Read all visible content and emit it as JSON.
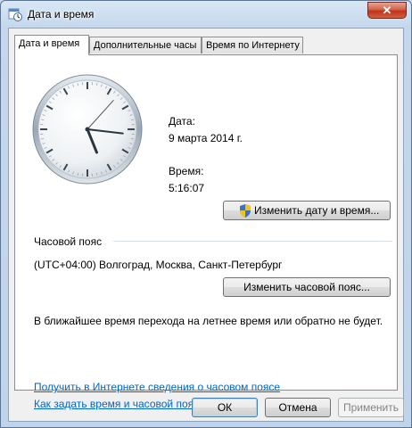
{
  "window": {
    "title": "Дата и время",
    "close_symbol": "✕"
  },
  "tabs": [
    {
      "label": "Дата и время",
      "active": true
    },
    {
      "label": "Дополнительные часы",
      "active": false
    },
    {
      "label": "Время по Интернету",
      "active": false
    }
  ],
  "datetime": {
    "date_label": "Дата:",
    "date_value": "9 марта 2014 г.",
    "time_label": "Время:",
    "time_value": "5:16:07",
    "change_button": "Изменить дату и время..."
  },
  "timezone": {
    "section_label": "Часовой пояс",
    "value": "(UTC+04:00) Волгоград, Москва, Санкт-Петербург",
    "change_button": "Изменить часовой пояс...",
    "dst_note": "В ближайшее время перехода на летнее время или обратно не будет."
  },
  "links": {
    "online_info": "Получить в Интернете сведения о часовом поясе",
    "how_to": "Как задать время и часовой пояс?"
  },
  "buttons": {
    "ok": "ОК",
    "cancel": "Отмена",
    "apply": "Применить"
  },
  "clock": {
    "hours": 5,
    "minutes": 16,
    "seconds": 7
  }
}
